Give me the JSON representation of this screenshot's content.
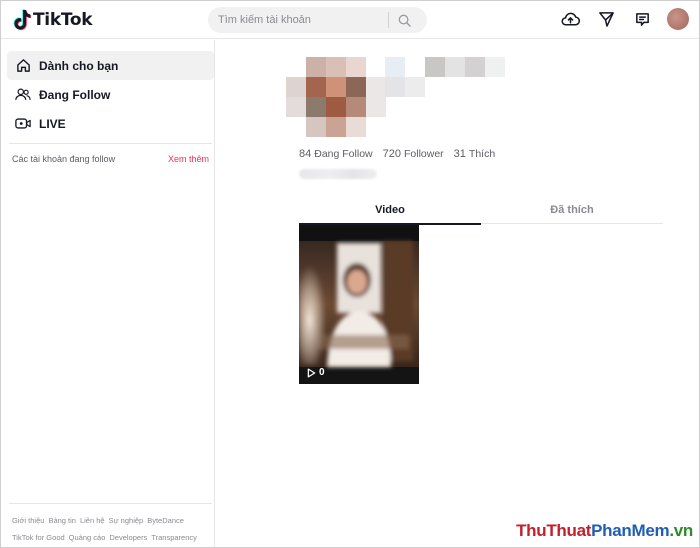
{
  "header": {
    "logo_text": "TikTok",
    "search": {
      "placeholder": "Tìm kiếm tài khoản"
    },
    "icons": [
      "upload-icon",
      "send-icon",
      "inbox-icon",
      "avatar"
    ]
  },
  "sidebar": {
    "nav": [
      {
        "label": "Dành cho bạn",
        "icon": "home-icon"
      },
      {
        "label": "Đang Follow",
        "icon": "following-icon"
      },
      {
        "label": "LIVE",
        "icon": "live-icon"
      }
    ],
    "following_title": "Các tài khoản đang follow",
    "see_more": "Xem thêm",
    "footer_row1": [
      "Giới thiệu",
      "Bảng tin",
      "Liên hệ",
      "Sự nghiệp",
      "ByteDance"
    ],
    "footer_row2": [
      "TikTok for Good",
      "Quảng cáo",
      "Developers",
      "Transparency"
    ]
  },
  "profile": {
    "stats": [
      {
        "value": "84",
        "label": "Đang Follow"
      },
      {
        "value": "720",
        "label": "Follower"
      },
      {
        "value": "31",
        "label": "Thích"
      }
    ],
    "tabs": [
      "Video",
      "Đã thích"
    ],
    "active_tab": "Video",
    "videos": [
      {
        "views": "0"
      }
    ]
  },
  "watermark": {
    "part1": "ThuThuat",
    "part2": "PhanMem",
    "part3": ".vn"
  },
  "colors": {
    "accent": "#fe2c55",
    "text": "#161823",
    "muted": "#8a8b91"
  }
}
